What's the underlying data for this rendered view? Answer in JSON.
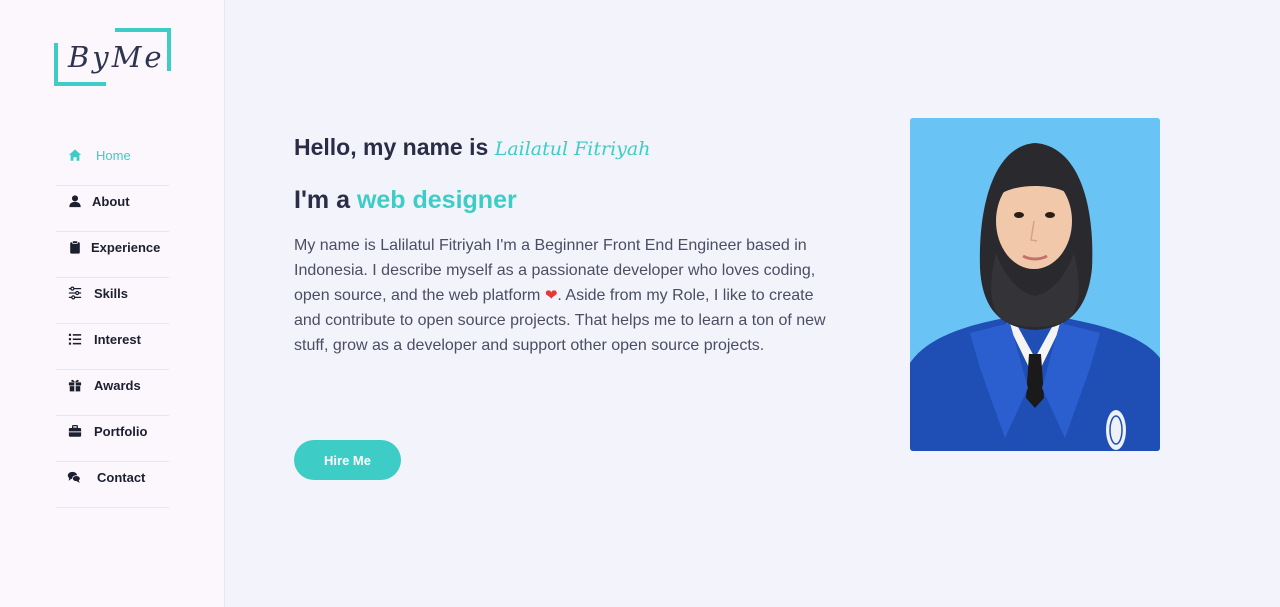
{
  "logo": {
    "text": "ByMe"
  },
  "nav": {
    "items": [
      {
        "label": "Home",
        "icon": "home-icon"
      },
      {
        "label": "About",
        "icon": "user-icon"
      },
      {
        "label": "Experience",
        "icon": "clipboard-icon"
      },
      {
        "label": "Skills",
        "icon": "sliders-icon"
      },
      {
        "label": "Interest",
        "icon": "list-icon"
      },
      {
        "label": "Awards",
        "icon": "gift-icon"
      },
      {
        "label": "Portfolio",
        "icon": "briefcase-icon"
      },
      {
        "label": "Contact",
        "icon": "comments-icon"
      }
    ],
    "active_index": 0
  },
  "hero": {
    "greeting_prefix": "Hello, my name is",
    "name": "Lailatul Fitriyah",
    "role_prefix": "I'm a",
    "role": "web designer",
    "bio_before_heart": "My name is Lalilatul Fitriyah I'm a Beginner Front End Engineer based in Indonesia. I describe myself as a passionate developer who loves coding, open source, and the web platform",
    "heart": "❤",
    "bio_after_heart": ". Aside from my Role, I like to create and contribute to open source projects. That helps me to learn a ton of new stuff, grow as a developer and support other open source projects.",
    "hire_button": "Hire Me"
  },
  "colors": {
    "accent": "#3ecdc6",
    "sidebar_bg": "#fbf7fd",
    "main_bg": "#f2f3fb",
    "text_dark": "#2a2d45",
    "photo_bg": "#69c3f5"
  }
}
